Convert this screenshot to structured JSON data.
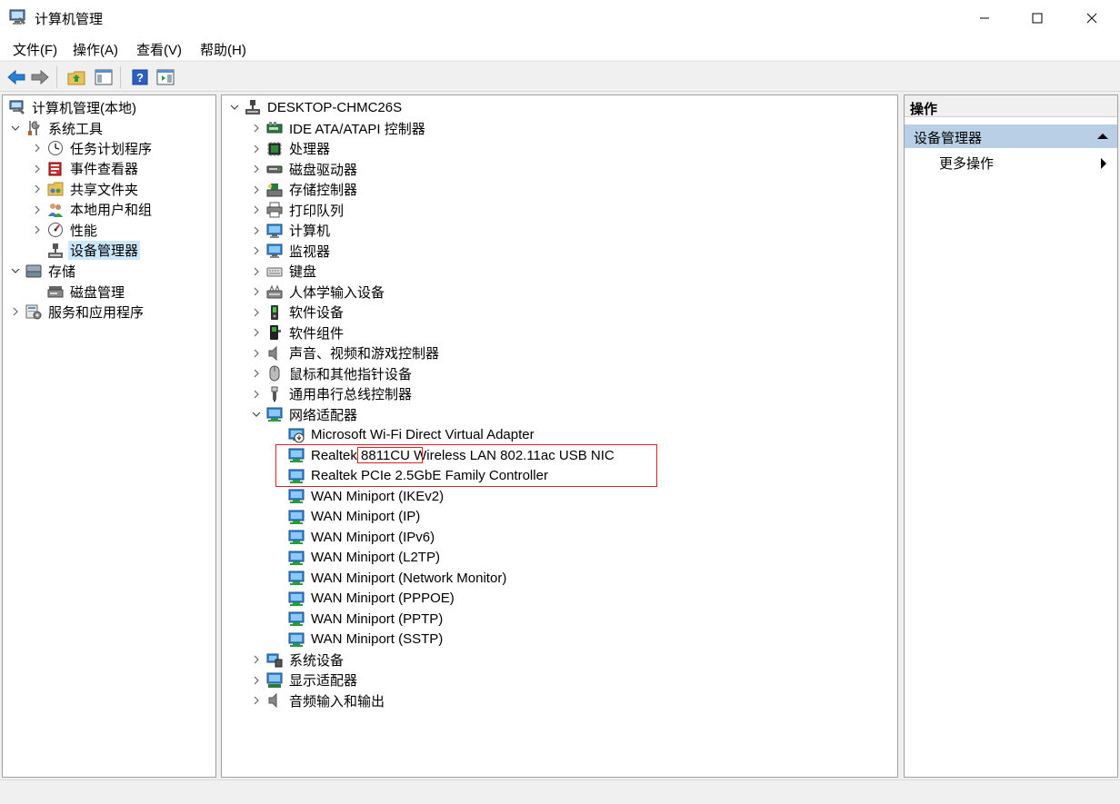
{
  "window": {
    "title": "计算机管理"
  },
  "menu": [
    "文件(F)",
    "操作(A)",
    "查看(V)",
    "帮助(H)"
  ],
  "left_tree": {
    "root": "计算机管理(本地)",
    "system_tools": "系统工具",
    "system_tools_children": [
      "任务计划程序",
      "事件查看器",
      "共享文件夹",
      "本地用户和组",
      "性能",
      "设备管理器"
    ],
    "storage": "存储",
    "storage_children": [
      "磁盘管理"
    ],
    "services": "服务和应用程序"
  },
  "device_tree": {
    "computer_name": "DESKTOP-CHMC26S",
    "categories_before": [
      "IDE ATA/ATAPI 控制器",
      "处理器",
      "磁盘驱动器",
      "存储控制器",
      "打印队列",
      "计算机",
      "监视器",
      "键盘",
      "人体学输入设备",
      "软件设备",
      "软件组件",
      "声音、视频和游戏控制器",
      "鼠标和其他指针设备",
      "通用串行总线控制器"
    ],
    "network_category": "网络适配器",
    "network_adapters": [
      "Microsoft Wi-Fi Direct Virtual Adapter",
      "Realtek 8811CU Wireless LAN 802.11ac USB NIC",
      "Realtek PCIe 2.5GbE Family Controller",
      "WAN Miniport (IKEv2)",
      "WAN Miniport (IP)",
      "WAN Miniport (IPv6)",
      "WAN Miniport (L2TP)",
      "WAN Miniport (Network Monitor)",
      "WAN Miniport (PPPOE)",
      "WAN Miniport (PPTP)",
      "WAN Miniport (SSTP)"
    ],
    "categories_after": [
      "系统设备",
      "显示适配器",
      "音频输入和输出"
    ]
  },
  "actions_pane": {
    "header": "操作",
    "section": "设备管理器",
    "more": "更多操作"
  },
  "colors": {
    "selection": "#cce8ff",
    "section_bg": "#b8cfe6",
    "highlight": "#e02020"
  }
}
